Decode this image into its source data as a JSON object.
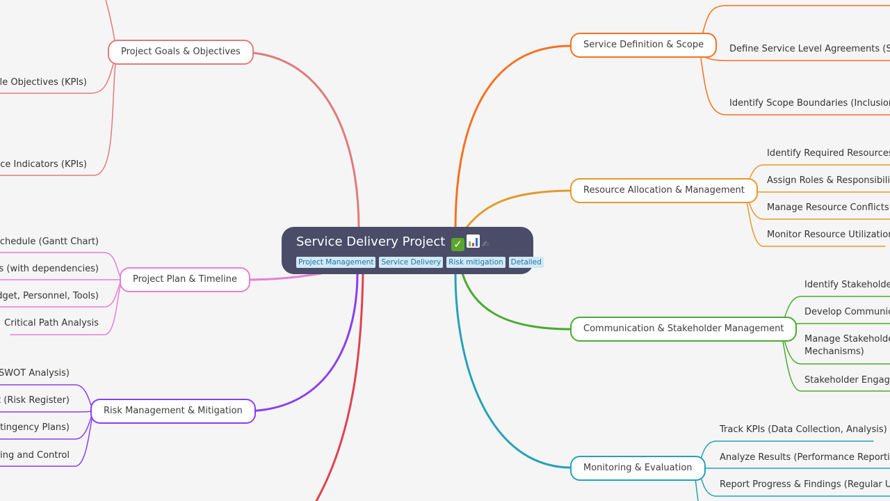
{
  "root": {
    "title": "Service Delivery Project",
    "emojis": [
      "check-mark-icon",
      "bar-chart-icon",
      "writing-hand-icon"
    ],
    "tags": [
      "Project Management",
      "Service Delivery",
      "Risk mitigation",
      "Detailed"
    ],
    "background": "#4a4c68"
  },
  "branches": [
    {
      "id": "goals",
      "label": "Project Goals & Objectives",
      "color": "#e07b7b",
      "side": "left",
      "children": [
        "able Objectives (KPIs)",
        "ance Indicators (KPIs)"
      ]
    },
    {
      "id": "plan",
      "label": "Project Plan & Timeline",
      "color": "#e77fd6",
      "side": "left",
      "children": [
        "t Schedule (Gantt Chart)",
        "les (with dependencies)",
        "udget, Personnel, Tools)",
        "Critical Path Analysis"
      ]
    },
    {
      "id": "risk",
      "label": "Risk Management & Mitigation",
      "color": "#8b3ff0",
      "side": "left",
      "children": [
        "(SWOT Analysis)",
        "ct (Risk Register)",
        "ntingency Plans)",
        "oring and Control"
      ]
    },
    {
      "id": "service",
      "label": "Service Definition & Scope",
      "color": "#f57120",
      "side": "right",
      "children": [
        "Define Service Level Agreements (SLAs)",
        "Identify Scope Boundaries (Inclusions &"
      ]
    },
    {
      "id": "resource",
      "label": "Resource Allocation & Management",
      "color": "#e39a2d",
      "side": "right",
      "children": [
        "Identify Required Resources (P",
        "Assign Roles & Responsibilitie",
        "Manage Resource Conflicts (Pr",
        "Monitor Resource Utilization"
      ]
    },
    {
      "id": "communication",
      "label": "Communication & Stakeholder Management",
      "color": "#4caa32",
      "side": "right",
      "children": [
        "Identify Stakeholders",
        "Develop Communica",
        "Manage Stakeholder Mechanisms)",
        "Stakeholder Engager"
      ]
    },
    {
      "id": "monitoring",
      "label": "Monitoring & Evaluation",
      "color": "#25a2b8",
      "side": "right",
      "children": [
        "Track KPIs (Data Collection, Analysis)",
        "Analyze Results (Performance Reporting,",
        "Report Progress & Findings (Regular Upda"
      ]
    }
  ],
  "offscreen_branch_color": "#e0414f"
}
